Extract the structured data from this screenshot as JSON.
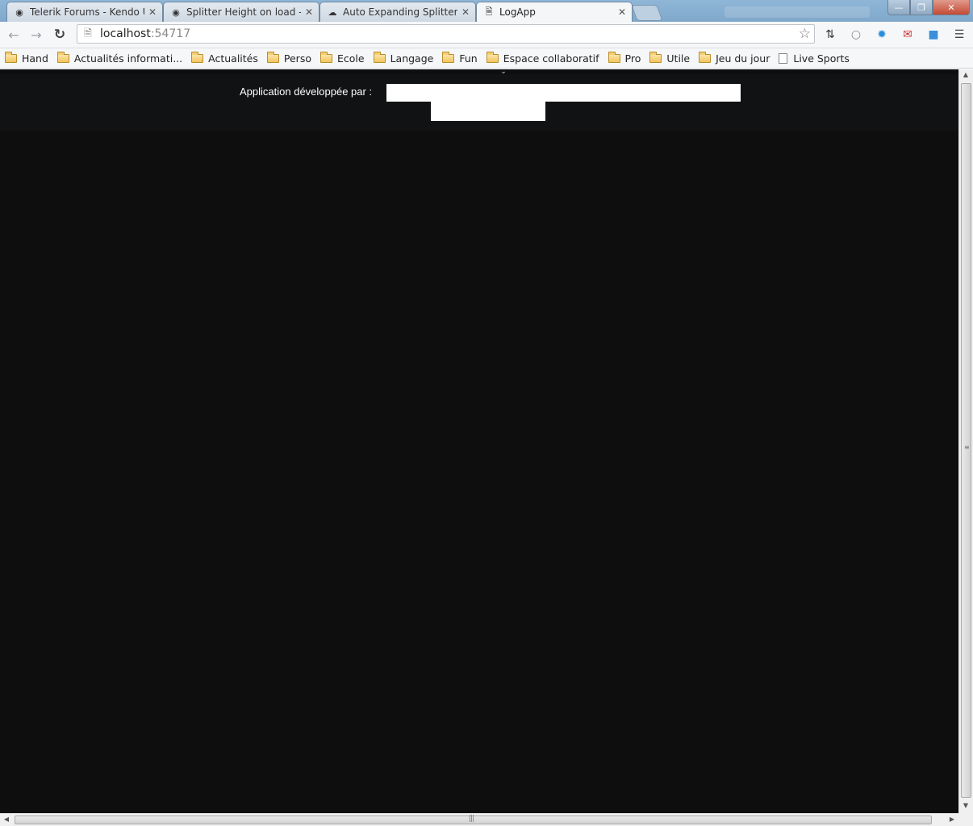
{
  "tabs": [
    {
      "title": "Telerik Forums - Kendo UI",
      "icon": "telerik-icon",
      "active": false
    },
    {
      "title": "Splitter Height on load - S",
      "icon": "telerik-icon",
      "active": false
    },
    {
      "title": "Auto Expanding Splitter - j",
      "icon": "cloud-icon",
      "active": false
    },
    {
      "title": "LogApp",
      "icon": "page-icon",
      "active": true
    }
  ],
  "address": {
    "host": "localhost",
    "port": ":54717"
  },
  "bookmarks": [
    {
      "label": "Hand",
      "type": "folder"
    },
    {
      "label": "Actualités informati...",
      "type": "folder"
    },
    {
      "label": "Actualités",
      "type": "folder"
    },
    {
      "label": "Perso",
      "type": "folder"
    },
    {
      "label": "Ecole",
      "type": "folder"
    },
    {
      "label": "Langage",
      "type": "folder"
    },
    {
      "label": "Fun",
      "type": "folder"
    },
    {
      "label": "Espace collaboratif",
      "type": "folder"
    },
    {
      "label": "Pro",
      "type": "folder"
    },
    {
      "label": "Utile",
      "type": "folder"
    },
    {
      "label": "Jeu du jour",
      "type": "folder"
    },
    {
      "label": "Live Sports",
      "type": "page"
    }
  ],
  "page": {
    "developer_label": "Application développée par :"
  },
  "colors": {
    "page_background": "#0e0e0f",
    "header_pane": "#111214",
    "redaction": "#ffffff"
  }
}
